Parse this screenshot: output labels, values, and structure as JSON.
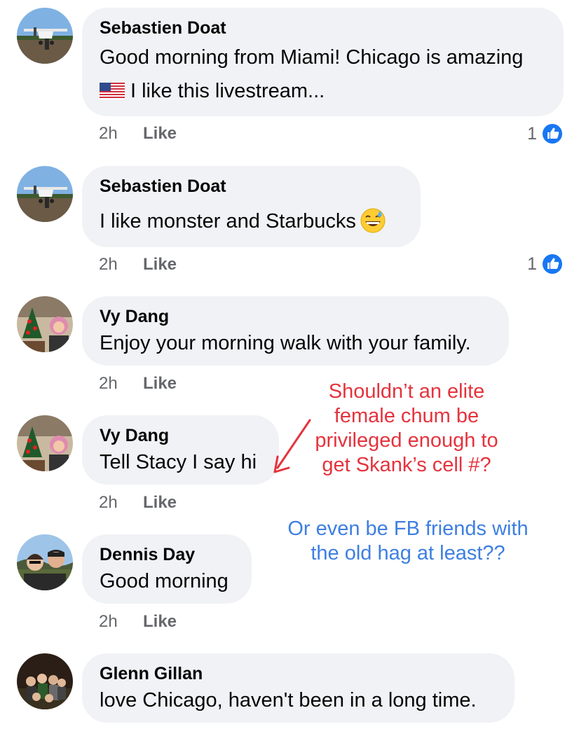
{
  "comments": [
    {
      "author": "Sebastien Doat",
      "lines": [
        "Good morning from Miami! Chicago is amazing",
        "I like this livestream..."
      ],
      "time": "2h",
      "like_label": "Like",
      "reaction_count": "1",
      "avatar": "airplane-photo"
    },
    {
      "author": "Sebastien Doat",
      "lines": [
        "I like monster and Starbucks"
      ],
      "time": "2h",
      "like_label": "Like",
      "reaction_count": "1",
      "avatar": "airplane-photo"
    },
    {
      "author": "Vy Dang",
      "lines": [
        "Enjoy your morning walk with your family."
      ],
      "time": "2h",
      "like_label": "Like",
      "avatar": "christmas-tree-selfie"
    },
    {
      "author": "Vy Dang",
      "lines": [
        "Tell Stacy I say hi"
      ],
      "time": "2h",
      "like_label": "Like",
      "avatar": "christmas-tree-selfie"
    },
    {
      "author": "Dennis Day",
      "lines": [
        "Good morning"
      ],
      "time": "2h",
      "like_label": "Like",
      "avatar": "couple-selfie"
    },
    {
      "author": "Glenn Gillan",
      "lines": [
        "love Chicago, haven't been in a long time."
      ],
      "avatar": "family-photo"
    }
  ],
  "annotations": {
    "red": [
      "Shouldn’t an elite",
      "female chum be",
      "privileged enough to",
      "get Skank’s cell #?"
    ],
    "blue": [
      "Or even be FB friends with",
      "the old hag at least??"
    ]
  },
  "icons": {
    "flag": "us-flag-icon",
    "emoji": "grinning-sweat-emoji",
    "reaction": "like-reaction-icon"
  },
  "colors": {
    "bubble": "#f0f2f5",
    "meta_text": "#65676b",
    "like_blue": "#1877f2",
    "annotation_red": "#e5333d",
    "annotation_blue": "#3e7fe2"
  }
}
